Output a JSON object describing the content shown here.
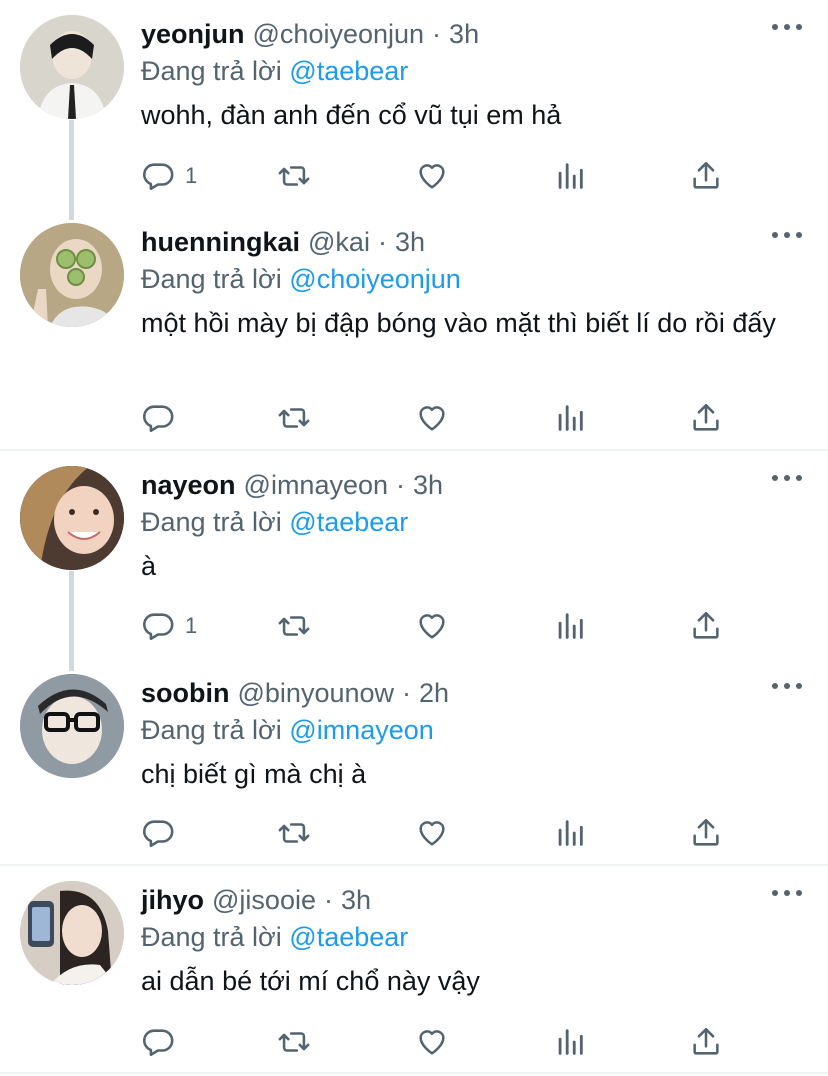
{
  "tweets": [
    {
      "name": "yeonjun",
      "handle": "@choiyeonjun",
      "time": "3h",
      "replying_prefix": "Đang trả lời",
      "replying_to": "@taebear",
      "text": "wohh, đàn anh đến cổ vũ tụi em hả",
      "reply_count": "1",
      "avatar_color": "#d9d6cf"
    },
    {
      "name": "huenningkai",
      "handle": "@kai",
      "time": "3h",
      "replying_prefix": "Đang trả lời",
      "replying_to": "@choiyeonjun",
      "text": "một hồi mày bị đập bóng vào mặt thì biết lí do rồi đấy",
      "reply_count": "",
      "avatar_color": "#b6a07a"
    },
    {
      "name": "nayeon",
      "handle": "@imnayeon",
      "time": "3h",
      "replying_prefix": "Đang trả lời",
      "replying_to": "@taebear",
      "text": "à",
      "reply_count": "1",
      "avatar_color": "#5b4438"
    },
    {
      "name": "soobin",
      "handle": "@binyounow",
      "time": "2h",
      "replying_prefix": "Đang trả lời",
      "replying_to": "@imnayeon",
      "text": "chị biết gì mà chị à",
      "reply_count": "",
      "avatar_color": "#9aa4ad"
    },
    {
      "name": "jihyo",
      "handle": "@jisooie",
      "time": "3h",
      "replying_prefix": "Đang trả lời",
      "replying_to": "@taebear",
      "text": "ai dẫn bé tới mí chổ này vậy",
      "reply_count": "",
      "avatar_color": "#cfc6bd"
    }
  ],
  "separator": "·",
  "icons": {
    "reply": "reply-icon",
    "retweet": "retweet-icon",
    "like": "heart-icon",
    "analytics": "analytics-icon",
    "share": "share-icon",
    "more": "more-icon"
  },
  "colors": {
    "name": "#0f1419",
    "secondary": "#536471",
    "mention": "#1d9bf0",
    "divider": "#eff3f4",
    "thread_line": "#cfd9de"
  }
}
